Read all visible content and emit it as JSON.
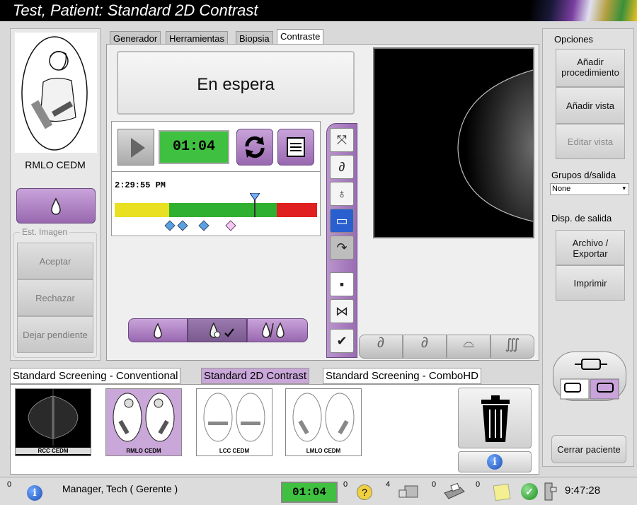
{
  "title": "Test, Patient:  Standard 2D Contrast",
  "left_panel": {
    "view_label": "RMLO CEDM",
    "image_state_legend": "Est. Imagen",
    "accept": "Aceptar",
    "reject": "Rechazar",
    "pend": "Dejar pendiente"
  },
  "tabs": [
    "Generador",
    "Herramientas",
    "Biopsia",
    "Contraste"
  ],
  "status_message": "En espera",
  "timer": "01:04",
  "timeline": {
    "clock": "2:29:55 PM",
    "marker_fraction": 0.69
  },
  "icons": {
    "play": "play-icon",
    "refresh": "refresh-icon",
    "notes": "notes-icon"
  },
  "right_panel": {
    "options_legend": "Opciones",
    "add_procedure": "Añadir procedimiento",
    "add_view": "Añadir vista",
    "edit_view": "Editar vista",
    "output_groups_label": "Grupos d/salida",
    "output_groups_value": "None",
    "output_devices_label": "Disp. de salida",
    "archive_export": "Archivo / Exportar",
    "print": "Imprimir",
    "close_patient": "Cerrar paciente"
  },
  "procedure_tabs": [
    "Standard Screening - Conventional",
    "Standard 2D Contrast",
    "Standard Screening - ComboHD"
  ],
  "thumbnails": [
    "RCC CEDM",
    "RMLO CEDM",
    "LCC CEDM",
    "LMLO CEDM"
  ],
  "statusbar": {
    "alert_count": "0",
    "user": "Manager, Tech ( Gerente )",
    "timer": "01:04",
    "count_a": "0",
    "count_b": "4",
    "count_c": "0",
    "count_d": "0",
    "time": "9:47:28"
  },
  "colors": {
    "purple": "#a878c0",
    "lcd_green": "#40c040",
    "bar_yellow": "#e8e020",
    "bar_green": "#30b030",
    "bar_red": "#e02020"
  }
}
